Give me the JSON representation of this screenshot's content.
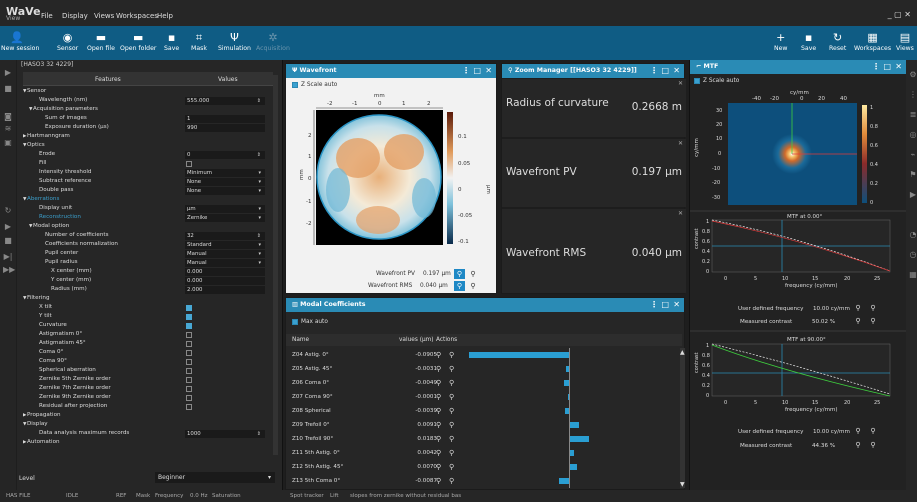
{
  "app": {
    "logo": "WaVe",
    "logo_sub": "View"
  },
  "menu": [
    "File",
    "Display",
    "Views",
    "Workspaces",
    "Help"
  ],
  "toolbar_left": [
    "New session",
    "Sensor",
    "Open file",
    "Open folder",
    "Save",
    "Mask",
    "Simulation",
    "Acquisition"
  ],
  "toolbar_right": [
    "New",
    "Save",
    "Reset",
    "Workspaces",
    "Views"
  ],
  "props": {
    "title": "[HASO3 32 4229]",
    "col_features": "Features",
    "col_values": "Values",
    "rows": [
      {
        "label": "Sensor",
        "indent": 0,
        "arrow": "▼",
        "type": "sec"
      },
      {
        "label": "Wavelength (nm)",
        "indent": 2,
        "value": "555.000",
        "type": "spin"
      },
      {
        "label": "Acquisition parameters",
        "indent": 1,
        "arrow": "▼",
        "type": "sec"
      },
      {
        "label": "Sum of images",
        "indent": 3,
        "value": "1",
        "type": "text"
      },
      {
        "label": "Exposure duration (µs)",
        "indent": 3,
        "value": "990",
        "type": "text"
      },
      {
        "label": "Hartmanngram",
        "indent": 0,
        "arrow": "▶",
        "type": "sec"
      },
      {
        "label": "Optics",
        "indent": 0,
        "arrow": "▼",
        "type": "sec"
      },
      {
        "label": "Erode",
        "indent": 2,
        "value": "0",
        "type": "spin"
      },
      {
        "label": "Fill",
        "indent": 2,
        "type": "check",
        "checked": false
      },
      {
        "label": "Intensity threshold",
        "indent": 2,
        "value": "Minimum",
        "type": "drop"
      },
      {
        "label": "Subtract reference",
        "indent": 2,
        "value": "None",
        "type": "drop"
      },
      {
        "label": "Double pass",
        "indent": 2,
        "value": "None",
        "type": "drop"
      },
      {
        "label": "Aberrations",
        "indent": 0,
        "arrow": "▼",
        "type": "secblue"
      },
      {
        "label": "Display unit",
        "indent": 2,
        "value": "µm",
        "type": "drop"
      },
      {
        "label": "Reconstruction",
        "indent": 2,
        "value": "Zernike",
        "type": "dropblue"
      },
      {
        "label": "Modal option",
        "indent": 1,
        "arrow": "▼",
        "type": "sec"
      },
      {
        "label": "Number of coefficients",
        "indent": 3,
        "value": "32",
        "type": "spin"
      },
      {
        "label": "Coefficients normalization",
        "indent": 3,
        "value": "Standard",
        "type": "drop"
      },
      {
        "label": "Pupil center",
        "indent": 3,
        "value": "Manual",
        "type": "drop"
      },
      {
        "label": "Pupil radius",
        "indent": 3,
        "value": "Manual",
        "type": "drop"
      },
      {
        "label": "X center (mm)",
        "indent": 4,
        "value": "0.000",
        "type": "text"
      },
      {
        "label": "Y center (mm)",
        "indent": 4,
        "value": "0.000",
        "type": "text"
      },
      {
        "label": "Radius (mm)",
        "indent": 4,
        "value": "2.000",
        "type": "text"
      },
      {
        "label": "Filtering",
        "indent": 0,
        "arrow": "▼",
        "type": "sec"
      },
      {
        "label": "X tilt",
        "indent": 2,
        "type": "check",
        "checked": true
      },
      {
        "label": "Y tilt",
        "indent": 2,
        "type": "check",
        "checked": true
      },
      {
        "label": "Curvature",
        "indent": 2,
        "type": "check",
        "checked": true
      },
      {
        "label": "Astigmatism 0°",
        "indent": 2,
        "type": "check",
        "checked": false
      },
      {
        "label": "Astigmatism 45°",
        "indent": 2,
        "type": "check",
        "checked": false
      },
      {
        "label": "Coma 0°",
        "indent": 2,
        "type": "check",
        "checked": false
      },
      {
        "label": "Coma 90°",
        "indent": 2,
        "type": "check",
        "checked": false
      },
      {
        "label": "Spherical aberration",
        "indent": 2,
        "type": "check",
        "checked": false
      },
      {
        "label": "Zernike 5th Zernike order",
        "indent": 2,
        "type": "check",
        "checked": false
      },
      {
        "label": "Zernike 7th Zernike order",
        "indent": 2,
        "type": "check",
        "checked": false
      },
      {
        "label": "Zernike 9th Zernike order",
        "indent": 2,
        "type": "check",
        "checked": false
      },
      {
        "label": "Residual after projection",
        "indent": 2,
        "type": "check",
        "checked": false
      },
      {
        "label": "Propagation",
        "indent": 0,
        "arrow": "▶",
        "type": "sec"
      },
      {
        "label": "Display",
        "indent": 0,
        "arrow": "▼",
        "type": "sec"
      },
      {
        "label": "Data analysis maximum records",
        "indent": 2,
        "value": "1000",
        "type": "spin"
      },
      {
        "label": "Automation",
        "indent": 0,
        "arrow": "▶",
        "type": "sec"
      }
    ],
    "level_label": "Level",
    "level_value": "Beginner"
  },
  "wavefront": {
    "title": "Wavefront",
    "zscale": "Z Scale auto",
    "unit_mm": "mm",
    "unit_um": "µm",
    "xticks": [
      "-2",
      "-1",
      "0",
      "1",
      "2"
    ],
    "yticks": [
      "2",
      "1",
      "0",
      "-1",
      "-2"
    ],
    "cticks": [
      "0.1",
      "0.05",
      "0",
      "-0.05",
      "-0.1"
    ],
    "pv_label": "Wavefront PV",
    "pv_value": "0.197 µm",
    "rms_label": "Wavefront RMS",
    "rms_value": "0.040 µm"
  },
  "zoom": {
    "title": "Zoom Manager [[HASO3 32 4229]]",
    "rows": [
      {
        "label": "Radius of curvature",
        "value": "0.2668 m"
      },
      {
        "label": "Wavefront PV",
        "value": "0.197 µm"
      },
      {
        "label": "Wavefront RMS",
        "value": "0.040 µm"
      }
    ]
  },
  "modal": {
    "title": "Modal Coefficients",
    "max_auto": "Max auto",
    "col_name": "Name",
    "col_values": "values (µm)",
    "col_actions": "Actions",
    "rows": [
      {
        "name": "Z04 Astig. 0°",
        "value": "-0.0905",
        "v": -0.0905
      },
      {
        "name": "Z05 Astig. 45°",
        "value": "-0.0031",
        "v": -0.0031
      },
      {
        "name": "Z06 Coma 0°",
        "value": "-0.0049",
        "v": -0.0049
      },
      {
        "name": "Z07 Coma 90°",
        "value": "-0.0001",
        "v": -0.0001
      },
      {
        "name": "Z08 Spherical",
        "value": "-0.0039",
        "v": -0.0039
      },
      {
        "name": "Z09 Trefoil 0°",
        "value": "0.0091",
        "v": 0.0091
      },
      {
        "name": "Z10 Trefoil 90°",
        "value": "0.0183",
        "v": 0.0183
      },
      {
        "name": "Z11 5th Astig. 0°",
        "value": "0.0042",
        "v": 0.0042
      },
      {
        "name": "Z12 5th Astig. 45°",
        "value": "0.0070",
        "v": 0.007
      },
      {
        "name": "Z13 5th Coma 0°",
        "value": "-0.0087",
        "v": -0.0087
      }
    ]
  },
  "mtf": {
    "title": "MTF",
    "zscale": "Z Scale auto",
    "unit_cy": "cy/mm",
    "map_xticks": [
      "-40",
      "-20",
      "0",
      "20",
      "40"
    ],
    "map_yticks": [
      "30",
      "20",
      "10",
      "0",
      "-10",
      "-20",
      "-30"
    ],
    "map_cticks": [
      "1",
      "0.8",
      "0.6",
      "0.4",
      "0.2",
      "0"
    ],
    "plot1_title": "MTF at 0.00°",
    "plot2_title": "MTF at 90.00°",
    "ylabel": "contrast",
    "xlabel": "frequency (cy/mm)",
    "xticks": [
      "0",
      "5",
      "10",
      "15",
      "20",
      "25"
    ],
    "yticks": [
      "1",
      "0.8",
      "0.6",
      "0.4",
      "0.2",
      "0"
    ],
    "freq_label": "User defined frequency",
    "freq_value": "10.00 cy/mm",
    "contrast_label": "Measured contrast",
    "contrast_value1": "50.02 %",
    "contrast_value2": "44.36 %"
  },
  "status": {
    "items": [
      "HAS FILE",
      "IDLE",
      "REF",
      "Mask",
      "Frequency",
      "0.0 Hz",
      "Saturation",
      "Spot tracker",
      "Lift",
      "slopes from zernike without residual bas"
    ]
  }
}
